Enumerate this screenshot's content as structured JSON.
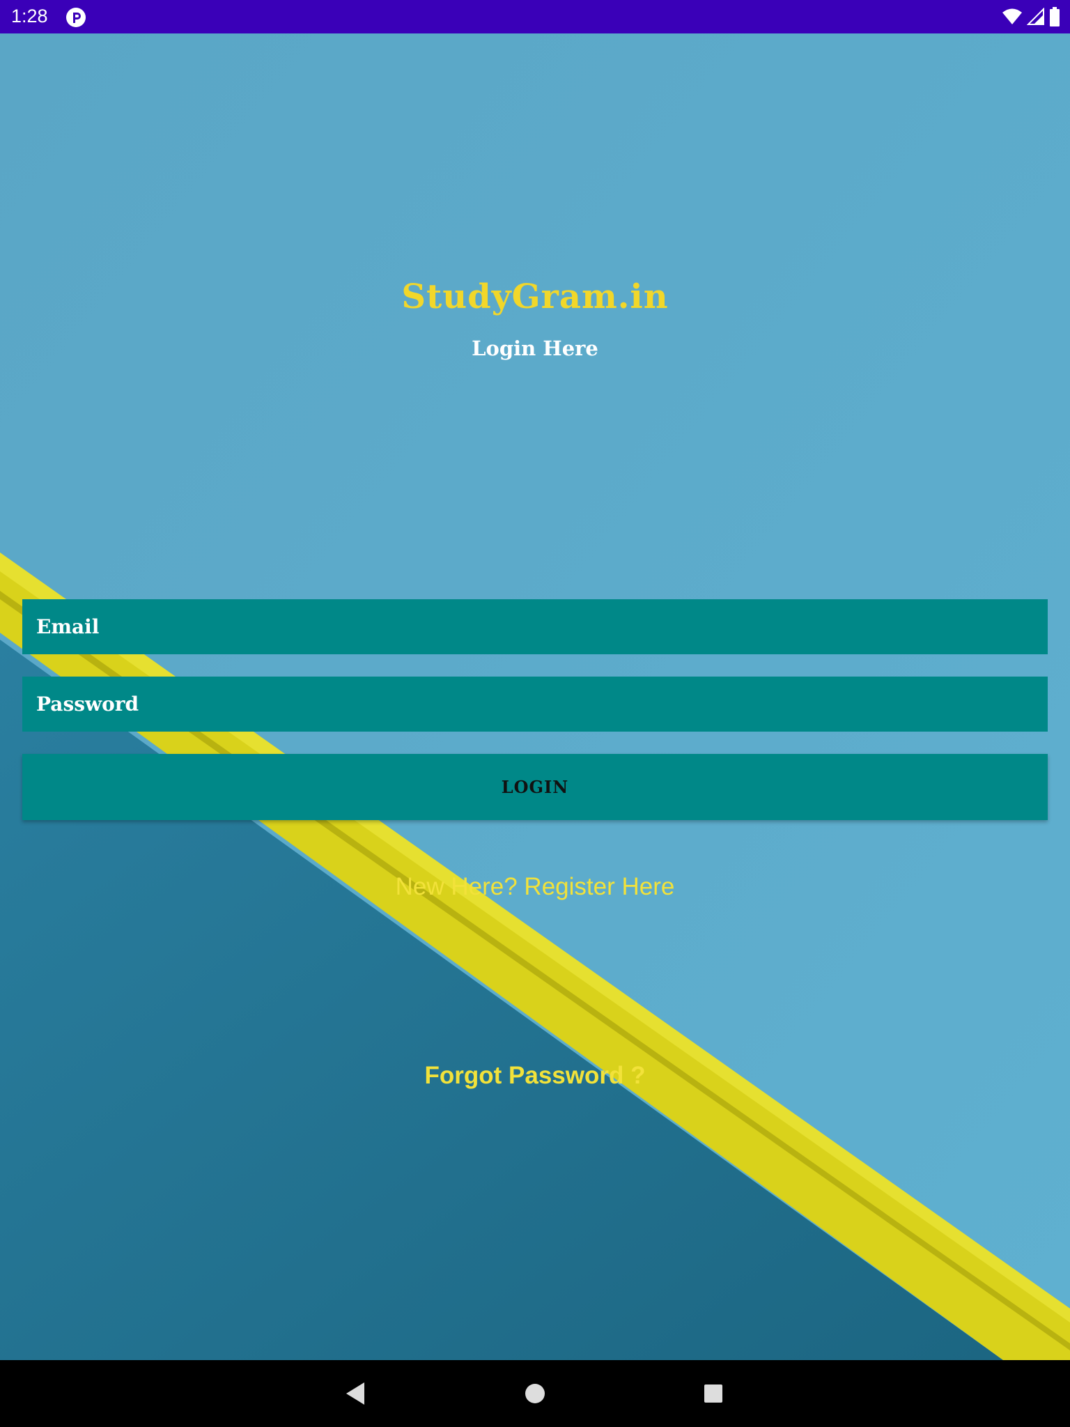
{
  "status_bar": {
    "time": "1:28",
    "app_icon": "parking-p-icon",
    "icons": [
      "wifi-icon",
      "cell-signal-icon",
      "battery-icon"
    ],
    "background_color": "#3a00b8"
  },
  "header": {
    "app_title": "StudyGram.in",
    "subtitle": "Login Here"
  },
  "form": {
    "email_placeholder": "Email",
    "password_placeholder": "Password",
    "login_label": "LOGIN",
    "field_color": "#008888"
  },
  "links": {
    "register": "New Here? Register Here",
    "forgot_password": "Forgot Password ?",
    "link_color": "#f2e23a"
  },
  "nav_bar": {
    "icons": [
      "back-icon",
      "home-icon",
      "recents-icon"
    ]
  },
  "colors": {
    "title": "#f2d72a",
    "background_light": "#5aa8c8",
    "background_dark": "#1f6f8f",
    "stripe": "#d8d21a"
  }
}
